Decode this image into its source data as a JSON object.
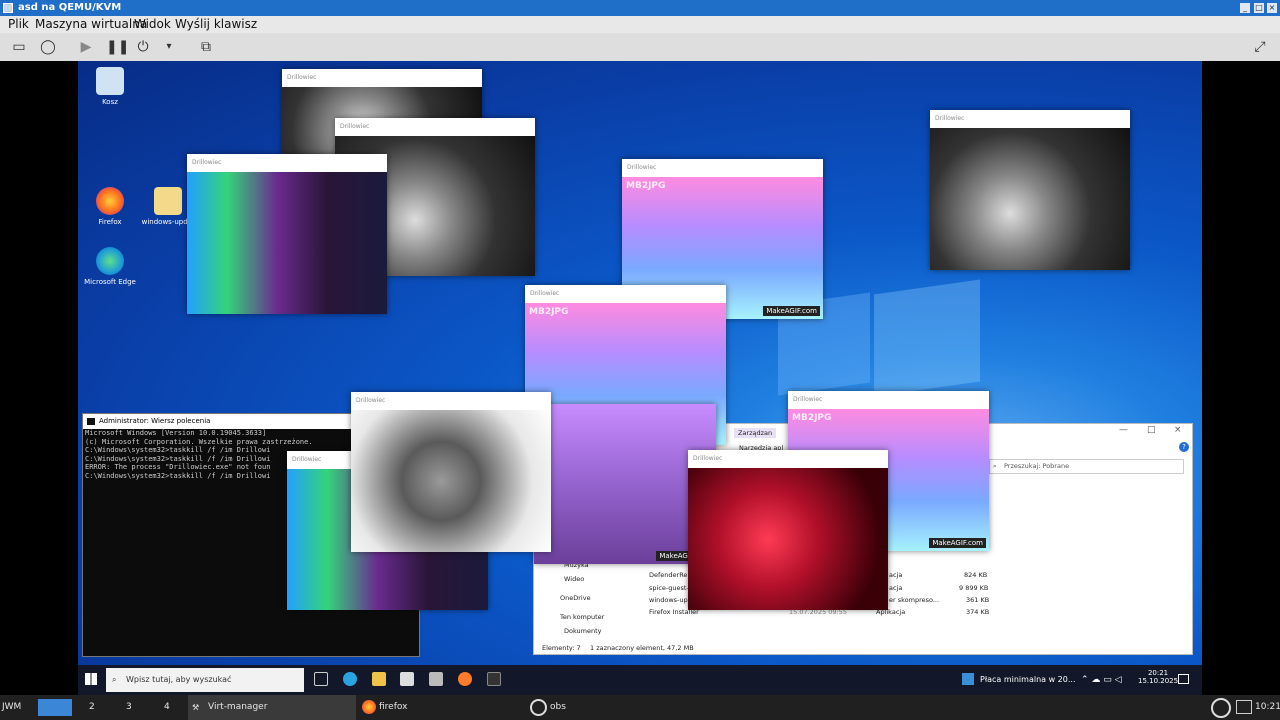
{
  "host_window": {
    "title": "asd na QEMU/KVM",
    "menu": [
      "Plik",
      "Maszyna wirtualna",
      "Widok",
      "Wyślij klawisz"
    ]
  },
  "desktop_icons": [
    {
      "label": "Kosz",
      "icon": "recycle-bin-icon"
    },
    {
      "label": "Firefox",
      "icon": "firefox-icon"
    },
    {
      "label": "windows-upd...",
      "icon": "folder-icon"
    },
    {
      "label": "Microsoft Edge",
      "icon": "edge-icon"
    }
  ],
  "popup_title": "Drillowiec",
  "watermark": "MakeAGIF.com",
  "popup_tag": "MB2JPG",
  "cmd": {
    "title": "Administrator: Wiersz polecenia",
    "lines": [
      "Microsoft Windows [Version 10.0.19045.3633]",
      "(c) Microsoft Corporation. Wszelkie prawa zastrzeżone.",
      "",
      "C:\\Windows\\system32>taskkill /f /im Drillowi",
      "",
      "C:\\Windows\\system32>taskkill /f /im Drillowi",
      "ERROR: The process \"Drillowiec.exe\" not foun",
      "",
      "C:\\Windows\\system32>taskkill /f /im Drillowi"
    ]
  },
  "explorer": {
    "ribbon": [
      "Zarządzan",
      "Narzędzia apl"
    ],
    "search_placeholder": "Przeszukaj: Pobrane",
    "nav": [
      "Muzyka",
      "Wideo",
      "OneDrive",
      "Ten komputer",
      "Dokumenty"
    ],
    "files": [
      {
        "name": "DefenderRe",
        "type": "acja",
        "size": "824 KB"
      },
      {
        "name": "spice-guest-",
        "type": "acja",
        "size": "9 899 KB"
      },
      {
        "name": "windows-up",
        "type": "er skompreso...",
        "size": "361 KB"
      },
      {
        "name": "Firefox Installer",
        "date": "15.07.2025 09:55",
        "type": "Aplikacja",
        "size": "374 KB"
      }
    ],
    "status_items": "Elementy: 7",
    "status_selected": "1 zaznaczony element, 47,2 MB"
  },
  "guest_taskbar": {
    "search_placeholder": "Wpisz tutaj, aby wyszukać",
    "news": "Płaca minimalna w 20...",
    "time": "20:21",
    "date": "15.10.2025"
  },
  "host_taskbar": {
    "menu": "JWM",
    "desktops": [
      "2",
      "3",
      "4"
    ],
    "tasks": [
      "Virt-manager",
      "firefox",
      "obs"
    ],
    "clock": "10:21"
  }
}
